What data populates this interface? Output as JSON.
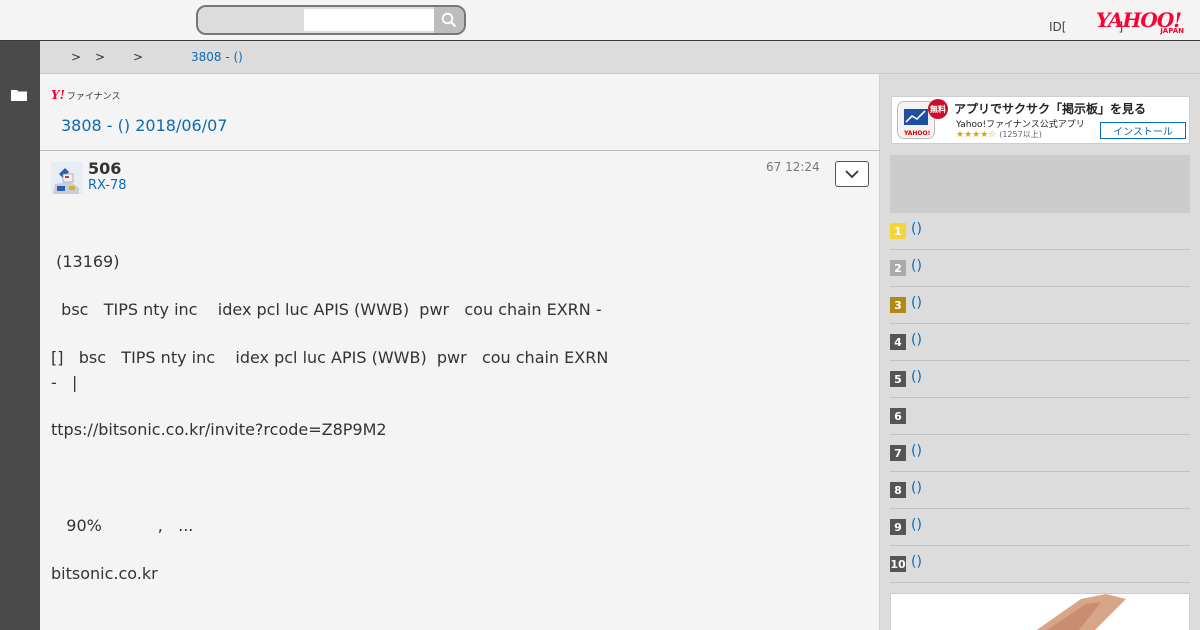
{
  "header": {
    "search_placeholder": "",
    "id_text": "ID[",
    "id_suffix": "]",
    "logo_main": "YAHOO!",
    "logo_sub": "JAPAN"
  },
  "breadcrumb": {
    "separators": [
      ">",
      ">",
      ">"
    ],
    "current": "3808 - ()"
  },
  "main": {
    "finance_logo_y": "Y!",
    "finance_logo_text": "ファイナンス",
    "page_title": "3808 - () 2018/06/07",
    "post": {
      "number": "506",
      "poster": "RX-78",
      "time": "67 12:24",
      "lines": [
        " (13169)",
        "  bsc   TIPS nty inc    idex pcl luc APIS (WWB)  pwr   cou chain EXRN -",
        "[]   bsc   TIPS nty inc    idex pcl luc APIS (WWB)  pwr   cou chain EXRN",
        "-   |",
        "ttps://bitsonic.co.kr/invite?rcode=Z8P9M2",
        "   90%           ,   ...",
        "bitsonic.co.kr"
      ]
    }
  },
  "sidebar_right": {
    "app_banner": {
      "badge": "無料",
      "title": "アプリでサクサク「掲示板」を見る",
      "subtitle": "Yahoo!ファイナンス公式アプリ",
      "stars": "★★★★☆",
      "count": "(1257以上)",
      "install_label": "インストール"
    },
    "ranking": [
      {
        "rank": "1",
        "label": "()",
        "color": "#f5d43a"
      },
      {
        "rank": "2",
        "label": "()",
        "color": "#aaaaaa"
      },
      {
        "rank": "3",
        "label": "()",
        "color": "#b08a14"
      },
      {
        "rank": "4",
        "label": "()",
        "color": "#555555"
      },
      {
        "rank": "5",
        "label": "()",
        "color": "#555555"
      },
      {
        "rank": "6",
        "label": "",
        "color": "#555555"
      },
      {
        "rank": "7",
        "label": "()",
        "color": "#555555"
      },
      {
        "rank": "8",
        "label": "()",
        "color": "#555555"
      },
      {
        "rank": "9",
        "label": "()",
        "color": "#555555"
      },
      {
        "rank": "10",
        "label": "()",
        "color": "#555555"
      }
    ]
  },
  "colors": {
    "link": "#0a6bb5",
    "brand": "#ff0033",
    "sidebar": "#4a4a4a"
  }
}
